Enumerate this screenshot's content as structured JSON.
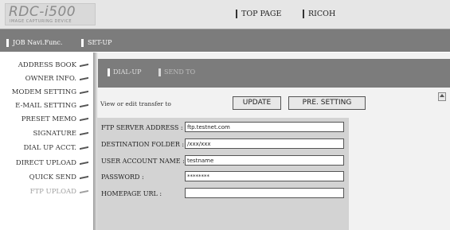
{
  "logo": {
    "title": "RDC-i500",
    "subtitle": "IMAGE CAPTURING DEVICE"
  },
  "top_links": [
    "TOP PAGE",
    "RICOH"
  ],
  "nav": [
    "JOB Navi.Func.",
    "SET-UP"
  ],
  "sidebar": {
    "items": [
      {
        "label": "ADDRESS BOOK",
        "active": false
      },
      {
        "label": "OWNER INFO.",
        "active": false
      },
      {
        "label": "MODEM SETTING",
        "active": false
      },
      {
        "label": "E-MAIL SETTING",
        "active": false
      },
      {
        "label": "PRESET MEMO",
        "active": false
      },
      {
        "label": "SIGNATURE",
        "active": false
      },
      {
        "label": "DIAL UP ACCT.",
        "active": false
      },
      {
        "label": "DIRECT UPLOAD",
        "active": false
      },
      {
        "label": "QUICK SEND",
        "active": false
      },
      {
        "label": "FTP UPLOAD",
        "active": true
      }
    ]
  },
  "tabs": [
    "DIAL-UP",
    "SEND TO"
  ],
  "instruction": "View or edit transfer to",
  "buttons": {
    "update": "UPDATE",
    "preset": "PRE. SETTING"
  },
  "form": {
    "ftp_server": {
      "label": "FTP SERVER ADDRESS :",
      "value": "ftp.testnet.com"
    },
    "destination": {
      "label": "DESTINATION FOLDER :",
      "value": "/xxx/xxx"
    },
    "user": {
      "label": "USER ACCOUNT NAME :",
      "value": "testname"
    },
    "password": {
      "label": "PASSWORD :",
      "value": "********"
    },
    "homepage": {
      "label": "HOMEPAGE URL :",
      "value": ""
    }
  },
  "icons": {
    "scroll_up": "scroll-up-arrow-icon"
  }
}
